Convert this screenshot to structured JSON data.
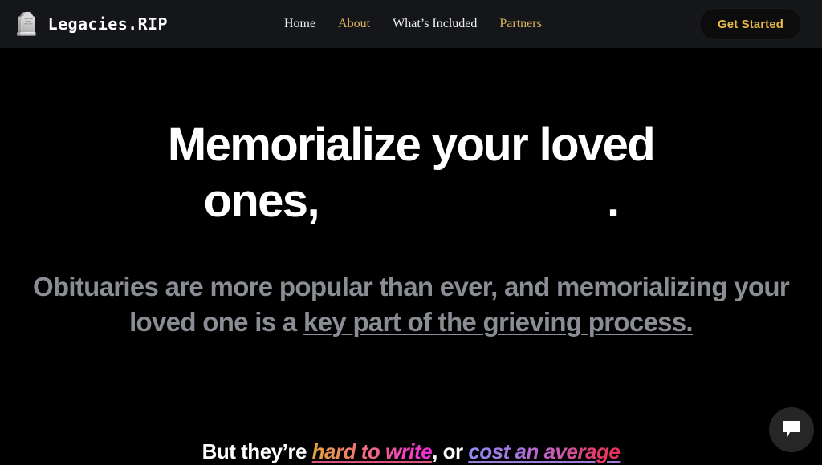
{
  "site": {
    "background": "#000000",
    "accent_gold": "#dcb45f",
    "muted_gray": "#8a8d93"
  },
  "header": {
    "background": "#141619",
    "brand": {
      "icon": "headstone-icon",
      "icon_glyph": "🪦",
      "name": "Legacies.RIP"
    },
    "nav": [
      {
        "label": "Home",
        "accent": false
      },
      {
        "label": "About",
        "accent": true
      },
      {
        "label": "What’s Included",
        "accent": false
      },
      {
        "label": "Partners",
        "accent": true
      }
    ],
    "cta": {
      "label": "Get Started",
      "text_color": "#e8b949",
      "background": "#0c0c0c"
    }
  },
  "hero": {
    "headline": {
      "line1": "Memorialize your loved",
      "line2_prefix": "ones,",
      "rotating_word": "",
      "line2_suffix": "."
    },
    "subheading": {
      "plain_1": "Obituaries are more popular than ever, and memorializing your loved one is a ",
      "link_text": "key part of the grieving process.",
      "color": "#8a8d93"
    },
    "tagline": {
      "prefix": "But they’re ",
      "link_1": "hard to write",
      "middle": ", or ",
      "link_2": "cost an average",
      "link_1_gradient": [
        "#e3a33c",
        "#f1628f",
        "#ef2ed8"
      ],
      "link_2_gradient": [
        "#8d8bf2",
        "#c95aae",
        "#e82f57"
      ]
    }
  },
  "chat_widget": {
    "icon": "chat-bubble-icon",
    "background": "#262626"
  }
}
